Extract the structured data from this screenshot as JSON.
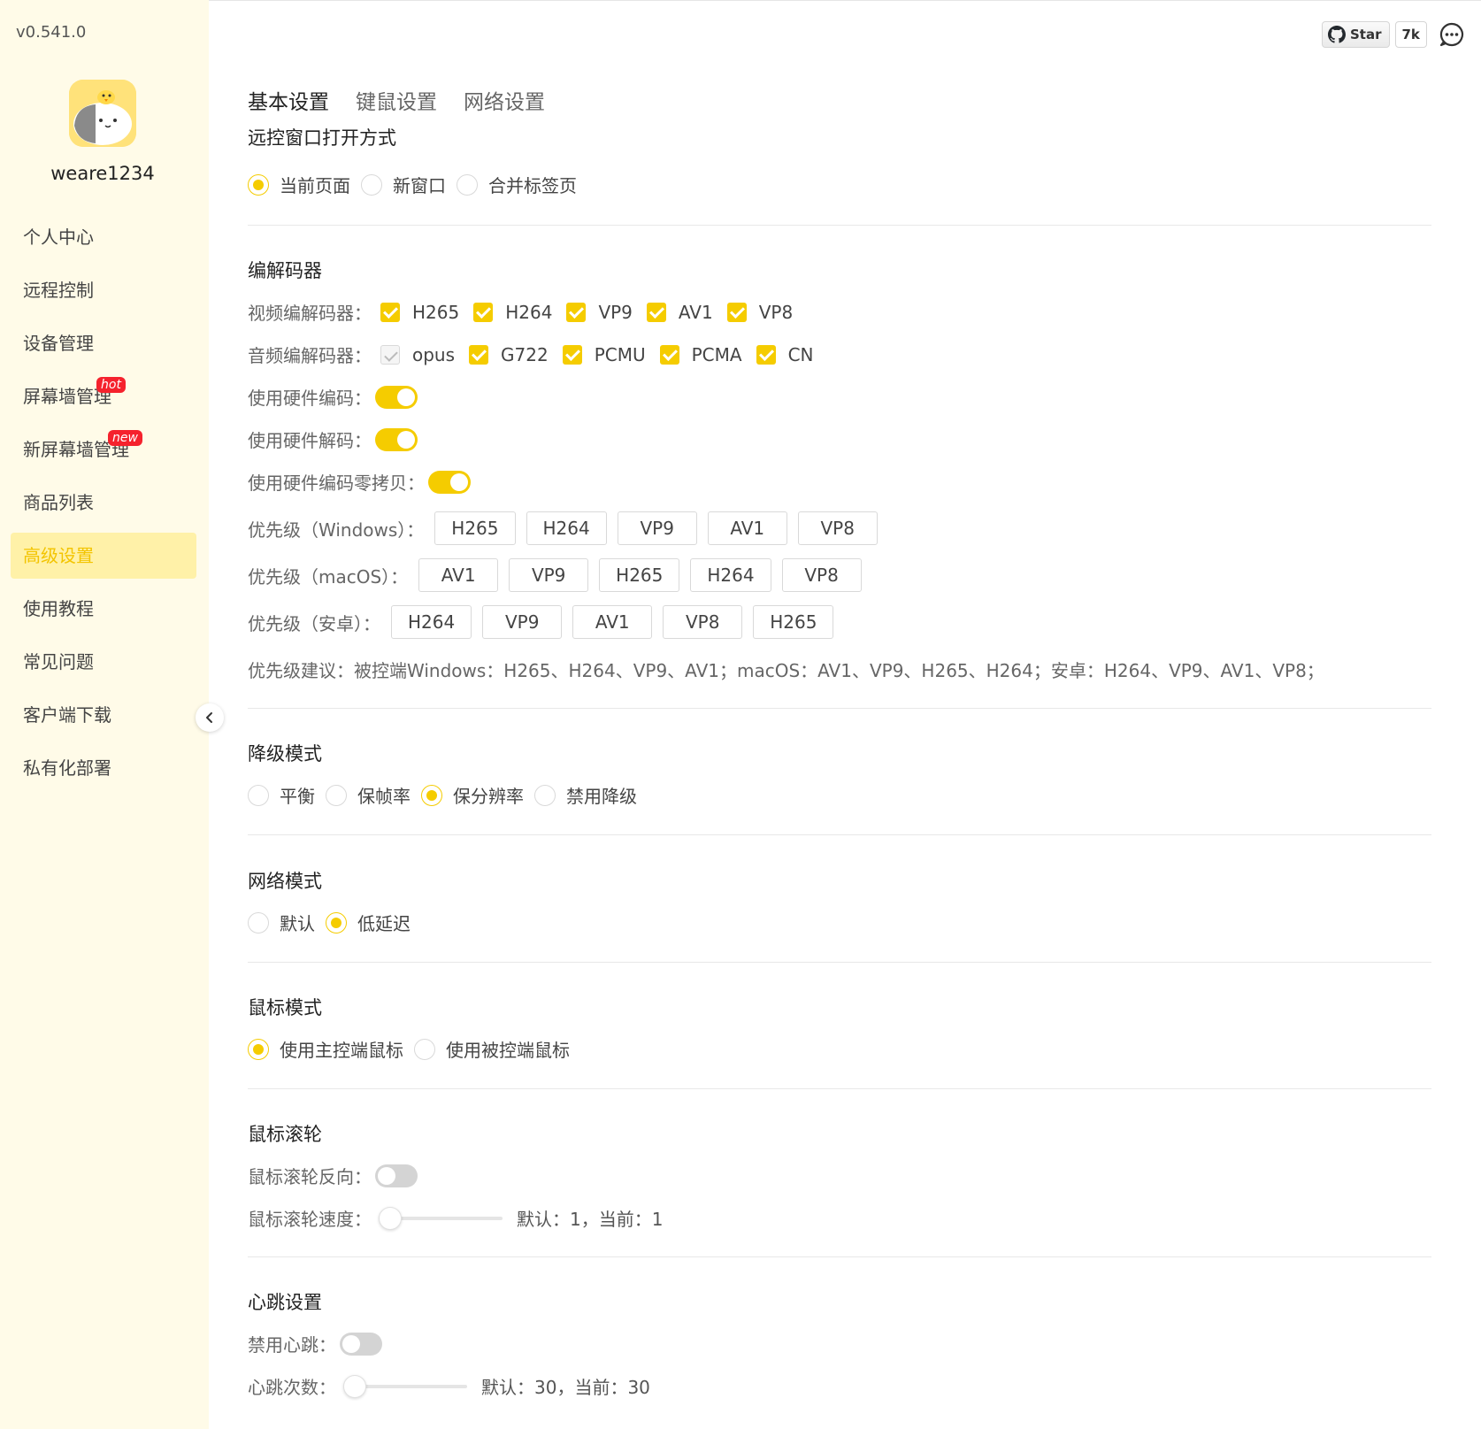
{
  "app": {
    "version": "v0.541.0",
    "username": "weare1234",
    "accent_color": "#f5cc00",
    "sidebar_bg": "#fffbe8"
  },
  "sidebar": {
    "items": [
      {
        "label": "个人中心"
      },
      {
        "label": "远程控制"
      },
      {
        "label": "设备管理"
      },
      {
        "label": "屏幕墙管理",
        "badge": "hot"
      },
      {
        "label": "新屏幕墙管理",
        "badge": "new"
      },
      {
        "label": "商品列表"
      },
      {
        "label": "高级设置",
        "active": true
      },
      {
        "label": "使用教程"
      },
      {
        "label": "常见问题"
      },
      {
        "label": "客户端下载"
      },
      {
        "label": "私有化部署"
      }
    ]
  },
  "header": {
    "github_star": "Star",
    "github_count": "7k"
  },
  "tabs": [
    "基本设置",
    "键鼠设置",
    "网络设置"
  ],
  "open_mode": {
    "title": "远控窗口打开方式",
    "options": [
      "当前页面",
      "新窗口",
      "合并标签页"
    ],
    "selected": 0
  },
  "codec": {
    "title": "编解码器",
    "video_label": "视频编解码器：",
    "video": [
      "H265",
      "H264",
      "VP9",
      "AV1",
      "VP8"
    ],
    "audio_label": "音频编解码器：",
    "audio": [
      "opus",
      "G722",
      "PCMU",
      "PCMA",
      "CN"
    ],
    "hw_encode_label": "使用硬件编码：",
    "hw_decode_label": "使用硬件解码：",
    "hw_zero_copy_label": "使用硬件编码零拷贝：",
    "priority_windows_label": "优先级（Windows）：",
    "priority_windows": [
      "H265",
      "H264",
      "VP9",
      "AV1",
      "VP8"
    ],
    "priority_macos_label": "优先级（macOS）：",
    "priority_macos": [
      "AV1",
      "VP9",
      "H265",
      "H264",
      "VP8"
    ],
    "priority_android_label": "优先级（安卓）：",
    "priority_android": [
      "H264",
      "VP9",
      "AV1",
      "VP8",
      "H265"
    ],
    "suggestion": "优先级建议：被控端Windows：H265、H264、VP9、AV1；macOS：AV1、VP9、H265、H264；安卓：H264、VP9、AV1、VP8；"
  },
  "downgrade": {
    "title": "降级模式",
    "options": [
      "平衡",
      "保帧率",
      "保分辨率",
      "禁用降级"
    ],
    "selected": 2
  },
  "network": {
    "title": "网络模式",
    "options": [
      "默认",
      "低延迟"
    ],
    "selected": 1
  },
  "mouse": {
    "title": "鼠标模式",
    "options": [
      "使用主控端鼠标",
      "使用被控端鼠标"
    ],
    "selected": 0
  },
  "wheel": {
    "title": "鼠标滚轮",
    "reverse_label": "鼠标滚轮反向：",
    "speed_label": "鼠标滚轮速度：",
    "speed_readout": "默认：1，当前：1",
    "speed_value": 1
  },
  "heartbeat": {
    "title": "心跳设置",
    "disable_label": "禁用心跳：",
    "count_label": "心跳次数：",
    "count_readout": "默认：30，当前：30",
    "count_value": 30
  }
}
